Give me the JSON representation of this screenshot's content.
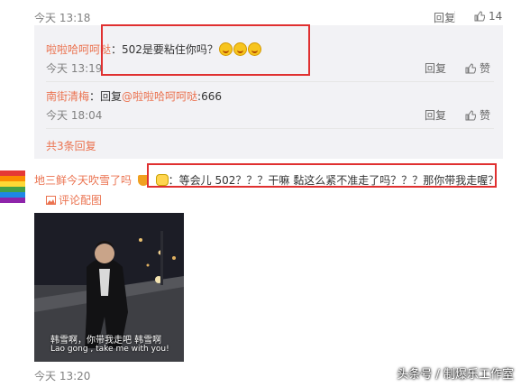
{
  "top_comment": {
    "time": "今天 13:18",
    "reply_label": "回复",
    "like_count": "14"
  },
  "replies": [
    {
      "user": "啦啦哈呵呵哒",
      "text": "：502是要粘住你吗？",
      "emoji_count": 3,
      "time": "今天 13:19",
      "reply_label": "回复",
      "like_label": "赞"
    },
    {
      "user": "南街清梅",
      "text_prefix": "：回复",
      "mention": "@啦啦哈呵呵哒",
      "text_suffix": ":666",
      "time": "今天 18:04",
      "reply_label": "回复",
      "like_label": "赞"
    }
  ],
  "more_replies": "共3条回复",
  "comment": {
    "user": "地三鲜今天吹雪了吗",
    "text": "：等会儿 502？？？干嘛 黏这么紧不准走了吗？？？那你带我走喔？",
    "view_image": "评论配图",
    "subtitle_cn": "韩雪啊，你带我走吧  韩雪啊",
    "subtitle_en": "Lao gong , take me with you!",
    "time": "今天 13:20"
  },
  "watermark": "头条号 / 制爆乐工作室",
  "colors": {
    "link": "#eb7350",
    "highlight_box": "#e03030",
    "reply_bg": "#f2f2f5"
  },
  "icons": [
    "thumbs-up-icon",
    "image-icon",
    "emoji-icon",
    "crown-badge-icon"
  ]
}
